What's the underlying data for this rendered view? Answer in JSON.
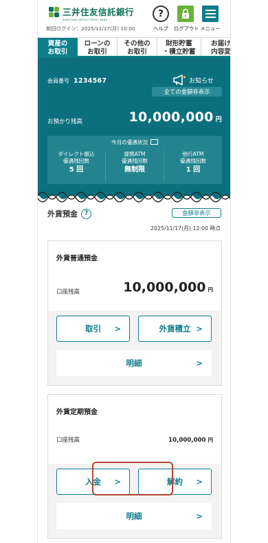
{
  "header": {
    "bank_name": "三井住友信託銀行",
    "bank_sub": "SUMITOMO MITSUI TRUST BANK",
    "last_login": "前回ログイン：2025/11/17(月) 10:00",
    "help_label": "ヘルプ",
    "logout_label": "ログアウト",
    "menu_label": "メニュー"
  },
  "tabs": [
    {
      "line1": "資産の",
      "line2": "お取引",
      "active": true
    },
    {
      "line1": "ローンの",
      "line2": "お取引",
      "active": false
    },
    {
      "line1": "その他の",
      "line2": "お取引",
      "active": false
    },
    {
      "line1": "財形貯蓄",
      "line2": "・積立貯蓄",
      "active": false
    },
    {
      "line1": "お届け",
      "line2": "内容変",
      "active": false
    }
  ],
  "summary": {
    "member_label": "会員番号",
    "member_number": "1234567",
    "notice_label": "お知らせ",
    "hide_all_label": "全ての金額非表示",
    "balance_label": "お預かり残高",
    "balance_value": "10,000,000",
    "currency_unit": "円",
    "perks_title": "今月の優遇状況",
    "perks": [
      {
        "line1": "ダイレクト振込",
        "line2": "優遇残回数",
        "value": "5 回"
      },
      {
        "line1": "提携ATM",
        "line2": "優遇残回数",
        "value": "無制限"
      },
      {
        "line1": "他行ATM",
        "line2": "優遇残回数",
        "value": "1 回"
      }
    ]
  },
  "fx": {
    "title": "外貨預金",
    "hide_label": "金額非表示",
    "as_of": "2025/11/17(月) 12:00 時点"
  },
  "cards": [
    {
      "title": "外貨普通預金",
      "balance_label": "口座残高",
      "balance_value": "10,000,000",
      "unit": "円",
      "btn_left": "取引",
      "btn_right": "外貨積立",
      "btn_detail": "明細"
    },
    {
      "title": "外貨定期預金",
      "balance_label": "口座残高",
      "balance_value": "10,000,000",
      "unit": "円",
      "btn_left": "入金",
      "btn_right": "解約",
      "btn_detail": "明細"
    }
  ],
  "colors": {
    "primary": "#0d7d8c",
    "summary_bg": "#0b6f7e",
    "brand_green": "#0e6f5c",
    "logout_green": "#6ab23a",
    "highlight": "#b5432e"
  }
}
